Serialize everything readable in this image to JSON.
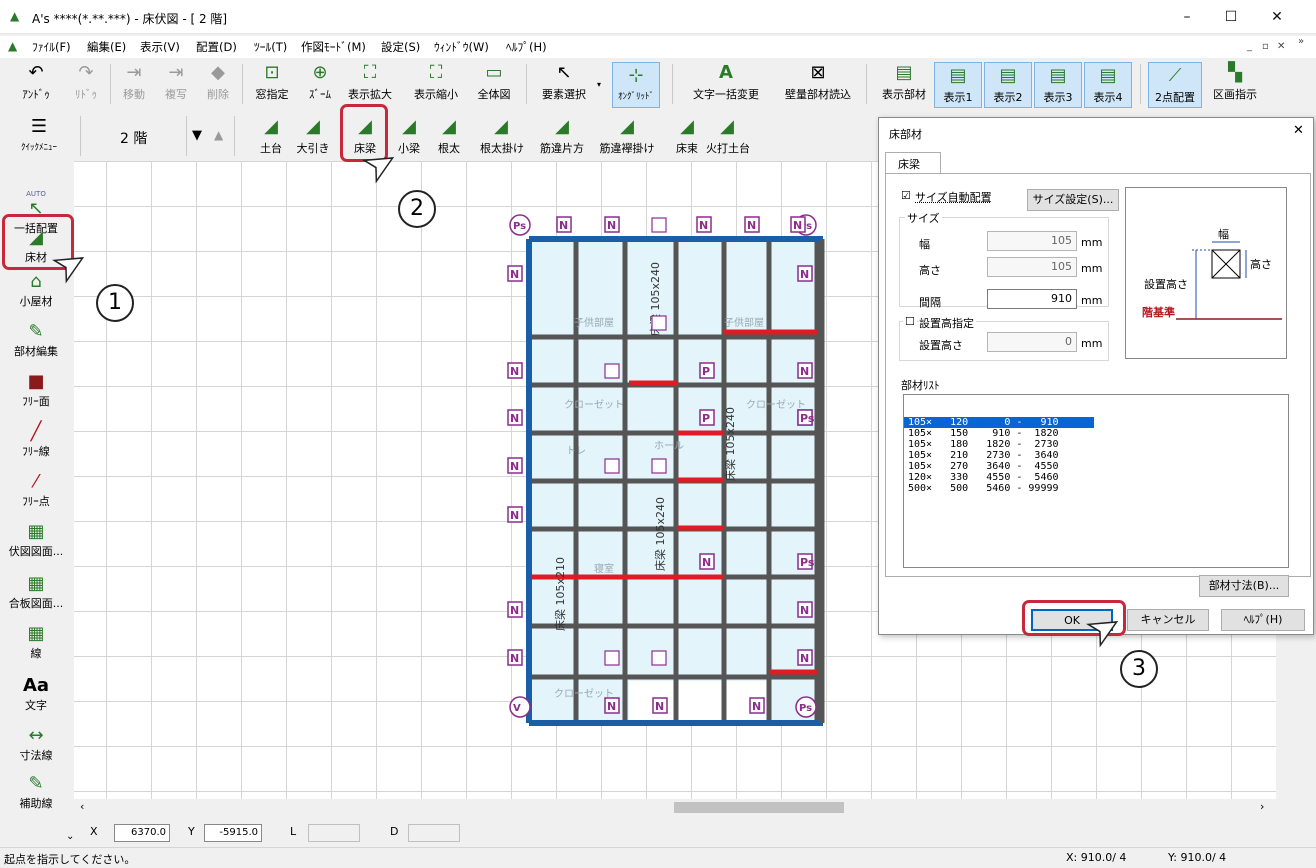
{
  "window": {
    "title": "A's ****(*.**.***) - 床伏図 - [ 2 階]",
    "min": "–",
    "max": "☐",
    "close": "✕"
  },
  "menu": [
    "ﾌｧｲﾙ(F)",
    "編集(E)",
    "表示(V)",
    "配置(D)",
    "ﾂｰﾙ(T)",
    "作図ﾓｰﾄﾞ(M)",
    "設定(S)",
    "ｳｨﾝﾄﾞｳ(W)",
    "ﾍﾙﾌﾟ(H)"
  ],
  "toolbar1": [
    {
      "label": "ｱﾝﾄﾞｩ",
      "icon": "undo-icon",
      "glyph": "↶"
    },
    {
      "label": "ﾘﾄﾞｩ",
      "icon": "redo-icon",
      "glyph": "↷"
    },
    {
      "label": "移動",
      "icon": "move-icon",
      "glyph": "⇥"
    },
    {
      "label": "複写",
      "icon": "copy-icon",
      "glyph": "⇥"
    },
    {
      "label": "削除",
      "icon": "erase-icon",
      "glyph": "◆"
    },
    {
      "label": "窓指定",
      "icon": "window-select-icon",
      "glyph": "⊡"
    },
    {
      "label": "ｽﾞｰﾑ",
      "icon": "zoom-icon",
      "glyph": "⊕"
    },
    {
      "label": "表示拡大",
      "icon": "zoom-in-icon",
      "glyph": "⛶"
    },
    {
      "label": "表示縮小",
      "icon": "zoom-out-icon",
      "glyph": "⛶"
    },
    {
      "label": "全体図",
      "icon": "fit-all-icon",
      "glyph": "▭"
    },
    {
      "label": "要素選択",
      "icon": "select-arrow-icon",
      "glyph": "↖"
    },
    {
      "label": "ｵﾝｸﾞﾘｯﾄﾞ",
      "icon": "on-grid-icon",
      "glyph": "⊹"
    },
    {
      "label": "文字一括変更",
      "icon": "text-batch-icon",
      "glyph": "A"
    },
    {
      "label": "壁量部材読込",
      "icon": "wall-load-icon",
      "glyph": "⊠"
    },
    {
      "label": "表示部材",
      "icon": "display-member-icon",
      "glyph": "▤"
    },
    {
      "label": "表示1",
      "icon": "display1-icon",
      "glyph": "▤"
    },
    {
      "label": "表示2",
      "icon": "display2-icon",
      "glyph": "▤"
    },
    {
      "label": "表示3",
      "icon": "display3-icon",
      "glyph": "▤"
    },
    {
      "label": "表示4",
      "icon": "display4-icon",
      "glyph": "▤"
    },
    {
      "label": "2点配置",
      "icon": "two-point-icon",
      "glyph": "⟋"
    },
    {
      "label": "区画指示",
      "icon": "section-icon",
      "glyph": "▚"
    }
  ],
  "quickmenu": {
    "label": "ｸｲｯｸﾒﾆｭｰ",
    "floor": "2 階"
  },
  "toolbar2": [
    {
      "label": "土台",
      "icon": "sill-icon"
    },
    {
      "label": "大引き",
      "icon": "sleeper-icon"
    },
    {
      "label": "床梁",
      "icon": "floor-beam-icon"
    },
    {
      "label": "小梁",
      "icon": "small-beam-icon"
    },
    {
      "label": "根太",
      "icon": "joist-icon"
    },
    {
      "label": "根太掛け",
      "icon": "joist-hanger-icon"
    },
    {
      "label": "筋違片方",
      "icon": "brace-single-icon"
    },
    {
      "label": "筋違襷掛け",
      "icon": "brace-cross-icon"
    },
    {
      "label": "床束",
      "icon": "floor-post-icon"
    },
    {
      "label": "火打土台",
      "icon": "corner-brace-icon"
    }
  ],
  "left_tools": [
    {
      "label": "一括配置",
      "icon": "auto-arrow-icon",
      "glyph": "↖"
    },
    {
      "label": "床材",
      "icon": "floor-material-icon",
      "glyph": "◢"
    },
    {
      "label": "小屋材",
      "icon": "roof-material-icon",
      "glyph": "⌂"
    },
    {
      "label": "部材編集",
      "icon": "member-edit-icon",
      "glyph": "✎"
    },
    {
      "label": "ﾌﾘｰ面",
      "icon": "free-face-icon",
      "glyph": "■"
    },
    {
      "label": "ﾌﾘｰ線",
      "icon": "free-line-icon",
      "glyph": "╱"
    },
    {
      "label": "ﾌﾘｰ点",
      "icon": "free-point-icon",
      "glyph": "⁄"
    },
    {
      "label": "伏図図面...",
      "icon": "plan-drawing-icon",
      "glyph": "▦"
    },
    {
      "label": "合板図面...",
      "icon": "plywood-drawing-icon",
      "glyph": "▦"
    },
    {
      "label": "線",
      "icon": "line-icon",
      "glyph": "▦"
    },
    {
      "label": "文字",
      "icon": "text-icon",
      "glyph": "Aa"
    },
    {
      "label": "寸法線",
      "icon": "dimension-icon",
      "glyph": "↔"
    },
    {
      "label": "補助線",
      "icon": "guide-line-icon",
      "glyph": "✎"
    }
  ],
  "auto_caption": "AUTO",
  "callouts": [
    "1",
    "2",
    "3"
  ],
  "plan": {
    "rooms": [
      "子供部屋",
      "子供部屋",
      "クローゼット",
      "クローゼット",
      "トレ",
      "寝室",
      "クローゼット",
      "ホール"
    ],
    "beam_labels": [
      "床梁 105x240",
      "床梁 105x240",
      "床梁 105x240",
      "床梁 105x210"
    ],
    "markers": {
      "ps": "Ps",
      "n": "N",
      "p": "P",
      "v": "V"
    }
  },
  "dialog": {
    "title": "床部材",
    "tab": "床梁",
    "auto": "サイズ自動配置",
    "size_btn": "サイズ設定(S)...",
    "size_group": "サイズ",
    "width_label": "幅",
    "width": "105",
    "height_label": "高さ",
    "height": "105",
    "pitch_label": "間隔",
    "pitch": "910",
    "unit": "mm",
    "install_check": "設置高指定",
    "install_label": "設置高さ",
    "install": "0",
    "preview": {
      "w": "幅",
      "h": "高さ",
      "inst": "設置高さ",
      "base": "階基準"
    },
    "list_label": "部材ﾘｽﾄ",
    "list": [
      "105×   120      0 -   910",
      "105×   150    910 -  1820",
      "105×   180   1820 -  2730",
      "105×   210   2730 -  3640",
      "105×   270   3640 -  4550",
      "120×   330   4550 -  5460",
      "500×   500   5460 - 99999"
    ],
    "dims_btn": "部材寸法(B)...",
    "ok": "OK",
    "cancel": "キャンセル",
    "help": "ﾍﾙﾌﾟ(H)"
  },
  "coord": {
    "x_label": "X",
    "x": "6370.0",
    "y_label": "Y",
    "y": "-5915.0",
    "l_label": "L",
    "d_label": "D"
  },
  "status": {
    "message": "起点を指示してください。",
    "x": "X: 910.0/ 4",
    "y": "Y: 910.0/ 4"
  },
  "colors": {
    "accent": "#c8283c",
    "ps": "#8b2d8b",
    "beam": "#555555",
    "red_beam": "#e01b24",
    "sill": "#1b5ea8"
  }
}
